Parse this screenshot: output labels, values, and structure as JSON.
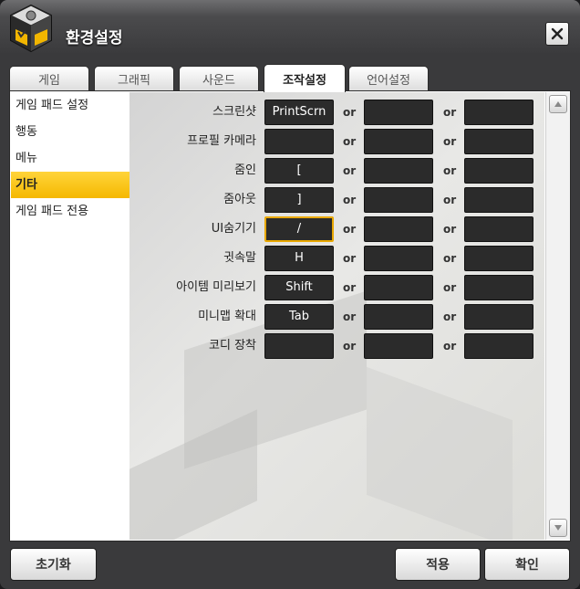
{
  "window": {
    "title": "환경설정"
  },
  "tabs": [
    {
      "label": "게임"
    },
    {
      "label": "그래픽"
    },
    {
      "label": "사운드"
    },
    {
      "label": "조작설정"
    },
    {
      "label": "언어설정"
    }
  ],
  "active_tab": "조작설정",
  "sidebar": {
    "items": [
      {
        "label": "게임 패드 설정"
      },
      {
        "label": "행동"
      },
      {
        "label": "메뉴"
      },
      {
        "label": "기타"
      },
      {
        "label": "게임 패드 전용"
      }
    ],
    "active": "기타"
  },
  "or_label": "or",
  "bindings": [
    {
      "label": "스크린샷",
      "key1": "PrintScrn",
      "key2": "",
      "key3": ""
    },
    {
      "label": "프로필 카메라",
      "key1": "",
      "key2": "",
      "key3": ""
    },
    {
      "label": "줌인",
      "key1": "[",
      "key2": "",
      "key3": ""
    },
    {
      "label": "줌아웃",
      "key1": "]",
      "key2": "",
      "key3": ""
    },
    {
      "label": "UI숨기기",
      "key1": "/",
      "key2": "",
      "key3": ""
    },
    {
      "label": "귓속말",
      "key1": "H",
      "key2": "",
      "key3": ""
    },
    {
      "label": "아이템 미리보기",
      "key1": "Shift",
      "key2": "",
      "key3": ""
    },
    {
      "label": "미니맵 확대",
      "key1": "Tab",
      "key2": "",
      "key3": ""
    },
    {
      "label": "코디 장착",
      "key1": "",
      "key2": "",
      "key3": ""
    }
  ],
  "buttons": {
    "reset": "초기화",
    "apply": "적용",
    "confirm": "확인"
  },
  "colors": {
    "accent": "#f5b800",
    "key_bg": "#2b2b2b",
    "frame": "#3a3a3c"
  }
}
